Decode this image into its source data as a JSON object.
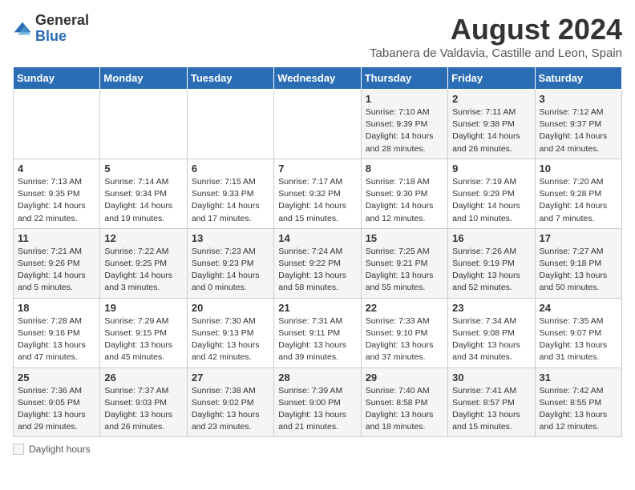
{
  "header": {
    "logo_general": "General",
    "logo_blue": "Blue",
    "title": "August 2024",
    "subtitle": "Tabanera de Valdavia, Castille and Leon, Spain"
  },
  "calendar": {
    "columns": [
      "Sunday",
      "Monday",
      "Tuesday",
      "Wednesday",
      "Thursday",
      "Friday",
      "Saturday"
    ],
    "weeks": [
      [
        {
          "day": "",
          "detail": ""
        },
        {
          "day": "",
          "detail": ""
        },
        {
          "day": "",
          "detail": ""
        },
        {
          "day": "",
          "detail": ""
        },
        {
          "day": "1",
          "detail": "Sunrise: 7:10 AM\nSunset: 9:39 PM\nDaylight: 14 hours\nand 28 minutes."
        },
        {
          "day": "2",
          "detail": "Sunrise: 7:11 AM\nSunset: 9:38 PM\nDaylight: 14 hours\nand 26 minutes."
        },
        {
          "day": "3",
          "detail": "Sunrise: 7:12 AM\nSunset: 9:37 PM\nDaylight: 14 hours\nand 24 minutes."
        }
      ],
      [
        {
          "day": "4",
          "detail": "Sunrise: 7:13 AM\nSunset: 9:35 PM\nDaylight: 14 hours\nand 22 minutes."
        },
        {
          "day": "5",
          "detail": "Sunrise: 7:14 AM\nSunset: 9:34 PM\nDaylight: 14 hours\nand 19 minutes."
        },
        {
          "day": "6",
          "detail": "Sunrise: 7:15 AM\nSunset: 9:33 PM\nDaylight: 14 hours\nand 17 minutes."
        },
        {
          "day": "7",
          "detail": "Sunrise: 7:17 AM\nSunset: 9:32 PM\nDaylight: 14 hours\nand 15 minutes."
        },
        {
          "day": "8",
          "detail": "Sunrise: 7:18 AM\nSunset: 9:30 PM\nDaylight: 14 hours\nand 12 minutes."
        },
        {
          "day": "9",
          "detail": "Sunrise: 7:19 AM\nSunset: 9:29 PM\nDaylight: 14 hours\nand 10 minutes."
        },
        {
          "day": "10",
          "detail": "Sunrise: 7:20 AM\nSunset: 9:28 PM\nDaylight: 14 hours\nand 7 minutes."
        }
      ],
      [
        {
          "day": "11",
          "detail": "Sunrise: 7:21 AM\nSunset: 9:26 PM\nDaylight: 14 hours\nand 5 minutes."
        },
        {
          "day": "12",
          "detail": "Sunrise: 7:22 AM\nSunset: 9:25 PM\nDaylight: 14 hours\nand 3 minutes."
        },
        {
          "day": "13",
          "detail": "Sunrise: 7:23 AM\nSunset: 9:23 PM\nDaylight: 14 hours\nand 0 minutes."
        },
        {
          "day": "14",
          "detail": "Sunrise: 7:24 AM\nSunset: 9:22 PM\nDaylight: 13 hours\nand 58 minutes."
        },
        {
          "day": "15",
          "detail": "Sunrise: 7:25 AM\nSunset: 9:21 PM\nDaylight: 13 hours\nand 55 minutes."
        },
        {
          "day": "16",
          "detail": "Sunrise: 7:26 AM\nSunset: 9:19 PM\nDaylight: 13 hours\nand 52 minutes."
        },
        {
          "day": "17",
          "detail": "Sunrise: 7:27 AM\nSunset: 9:18 PM\nDaylight: 13 hours\nand 50 minutes."
        }
      ],
      [
        {
          "day": "18",
          "detail": "Sunrise: 7:28 AM\nSunset: 9:16 PM\nDaylight: 13 hours\nand 47 minutes."
        },
        {
          "day": "19",
          "detail": "Sunrise: 7:29 AM\nSunset: 9:15 PM\nDaylight: 13 hours\nand 45 minutes."
        },
        {
          "day": "20",
          "detail": "Sunrise: 7:30 AM\nSunset: 9:13 PM\nDaylight: 13 hours\nand 42 minutes."
        },
        {
          "day": "21",
          "detail": "Sunrise: 7:31 AM\nSunset: 9:11 PM\nDaylight: 13 hours\nand 39 minutes."
        },
        {
          "day": "22",
          "detail": "Sunrise: 7:33 AM\nSunset: 9:10 PM\nDaylight: 13 hours\nand 37 minutes."
        },
        {
          "day": "23",
          "detail": "Sunrise: 7:34 AM\nSunset: 9:08 PM\nDaylight: 13 hours\nand 34 minutes."
        },
        {
          "day": "24",
          "detail": "Sunrise: 7:35 AM\nSunset: 9:07 PM\nDaylight: 13 hours\nand 31 minutes."
        }
      ],
      [
        {
          "day": "25",
          "detail": "Sunrise: 7:36 AM\nSunset: 9:05 PM\nDaylight: 13 hours\nand 29 minutes."
        },
        {
          "day": "26",
          "detail": "Sunrise: 7:37 AM\nSunset: 9:03 PM\nDaylight: 13 hours\nand 26 minutes."
        },
        {
          "day": "27",
          "detail": "Sunrise: 7:38 AM\nSunset: 9:02 PM\nDaylight: 13 hours\nand 23 minutes."
        },
        {
          "day": "28",
          "detail": "Sunrise: 7:39 AM\nSunset: 9:00 PM\nDaylight: 13 hours\nand 21 minutes."
        },
        {
          "day": "29",
          "detail": "Sunrise: 7:40 AM\nSunset: 8:58 PM\nDaylight: 13 hours\nand 18 minutes."
        },
        {
          "day": "30",
          "detail": "Sunrise: 7:41 AM\nSunset: 8:57 PM\nDaylight: 13 hours\nand 15 minutes."
        },
        {
          "day": "31",
          "detail": "Sunrise: 7:42 AM\nSunset: 8:55 PM\nDaylight: 13 hours\nand 12 minutes."
        }
      ]
    ]
  },
  "footer": {
    "daylight_label": "Daylight hours"
  }
}
